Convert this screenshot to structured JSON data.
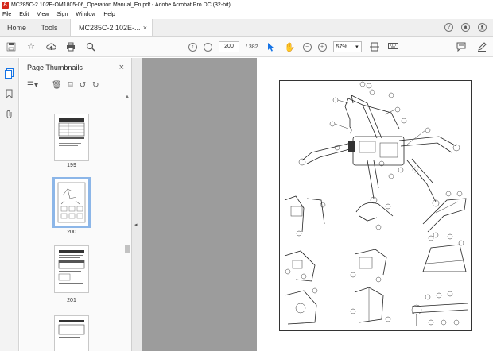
{
  "window": {
    "title": "MC285C-2 102E-OM1805-06_Operation Manual_En.pdf - Adobe Acrobat Pro DC (32-bit)"
  },
  "menu": [
    "File",
    "Edit",
    "View",
    "Sign",
    "Window",
    "Help"
  ],
  "tabs": {
    "home": "Home",
    "tools": "Tools",
    "doc": "MC285C-2 102E-...",
    "doc_close": "×"
  },
  "toolbar": {
    "page_current": "200",
    "page_total": "/ 382",
    "zoom": "57%",
    "zoom_caret": "▾"
  },
  "thumbs": {
    "title": "Page Thumbnails",
    "close": "×",
    "pages": [
      "199",
      "200",
      "201"
    ],
    "selected": "200"
  },
  "document": {
    "callouts": [
      "1",
      "2",
      "3",
      "4",
      "5",
      "6",
      "7",
      "8",
      "9",
      "10",
      "11",
      "12",
      "13",
      "14",
      "15",
      "16",
      "17",
      "18",
      "19",
      "20"
    ]
  },
  "colors": {
    "accent": "#1473e6",
    "selection": "#8cb6e8",
    "canvas": "#9c9c9c",
    "acrobat_red": "#d4281c"
  }
}
